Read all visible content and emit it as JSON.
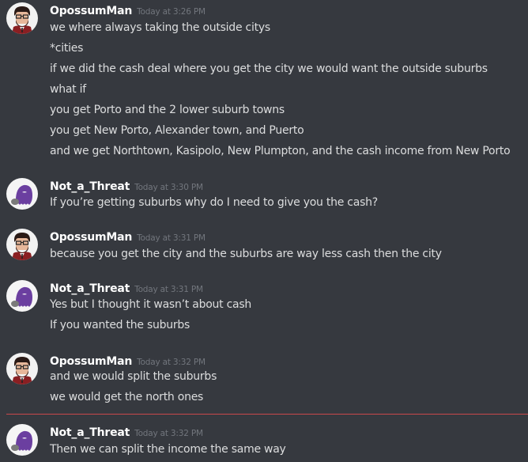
{
  "groups": [
    {
      "author": "OpossumMan",
      "timestamp": "Today at 3:26 PM",
      "avatar_icon": "opossum-character-avatar",
      "messages": [
        "we where always taking the outside citys",
        "*cities",
        "if we did the cash deal where you get the city we would want the outside suburbs",
        "what if",
        "you get Porto and the 2 lower suburb towns",
        "you get New Porto, Alexander town, and Puerto",
        "and we get Northtown, Kasipolo, New Plumpton, and the cash income from New Porto"
      ]
    },
    {
      "author": "Not_a_Threat",
      "timestamp": "Today at 3:30 PM",
      "avatar_icon": "purple-ghost-avatar",
      "messages": [
        "If you’re getting suburbs why do I need to give you the cash?"
      ]
    },
    {
      "author": "OpossumMan",
      "timestamp": "Today at 3:31 PM",
      "avatar_icon": "opossum-character-avatar",
      "messages": [
        "because you get the city and the suburbs are way less cash then the city"
      ]
    },
    {
      "author": "Not_a_Threat",
      "timestamp": "Today at 3:31 PM",
      "avatar_icon": "purple-ghost-avatar",
      "messages": [
        "Yes but I thought it wasn’t about cash",
        "If you wanted the suburbs"
      ]
    },
    {
      "author": "OpossumMan",
      "timestamp": "Today at 3:32 PM",
      "avatar_icon": "opossum-character-avatar",
      "messages": [
        "and we would split the suburbs",
        "we would get the north ones"
      ]
    },
    {
      "author": "Not_a_Threat",
      "timestamp": "Today at 3:32 PM",
      "avatar_icon": "purple-ghost-avatar",
      "messages": [
        "Then we can split the income the same way"
      ]
    }
  ],
  "colors": {
    "background": "#36393f",
    "username": "#ffffff",
    "timestamp": "#72767d",
    "message_text": "#dcddde",
    "new_messages_divider": "#c9484b",
    "ghost_purple": "#6b3fa0"
  }
}
